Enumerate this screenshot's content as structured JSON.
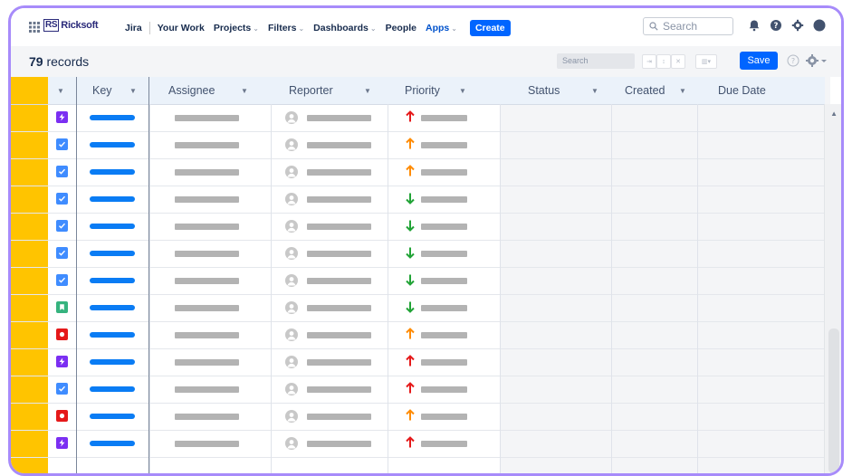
{
  "nav": {
    "brand": "Ricksoft",
    "brand_prefix": "RS",
    "product": "Jira",
    "items": [
      {
        "label": "Your Work",
        "caret": false
      },
      {
        "label": "Projects",
        "caret": true
      },
      {
        "label": "Filters",
        "caret": true
      },
      {
        "label": "Dashboards",
        "caret": true
      },
      {
        "label": "People",
        "caret": false
      },
      {
        "label": "Apps",
        "caret": true
      }
    ],
    "create_label": "Create",
    "search_placeholder": "Search"
  },
  "toolbar": {
    "records_count": "79",
    "records_label": "records",
    "search_placeholder": "Search",
    "save_label": "Save"
  },
  "columns": [
    "Key",
    "Assignee",
    "Reporter",
    "Priority",
    "Status",
    "Created",
    "Due Date"
  ],
  "colors": {
    "accent": "#0065ff",
    "row_marker": "#ffc400",
    "key_link": "#0a7cf4",
    "priority_highest": "#e5191a",
    "priority_high": "#ff8b00",
    "priority_low": "#21a336",
    "type_epic": "#7b2ff2",
    "type_task": "#3f8cff",
    "type_story": "#36b37e",
    "type_bug": "#e5191a"
  },
  "rows": [
    {
      "type": "epic",
      "priority": "highest"
    },
    {
      "type": "task",
      "priority": "high"
    },
    {
      "type": "task",
      "priority": "high"
    },
    {
      "type": "task",
      "priority": "low"
    },
    {
      "type": "task",
      "priority": "low"
    },
    {
      "type": "task",
      "priority": "low"
    },
    {
      "type": "task",
      "priority": "low"
    },
    {
      "type": "story",
      "priority": "low"
    },
    {
      "type": "bug",
      "priority": "high"
    },
    {
      "type": "epic",
      "priority": "highest"
    },
    {
      "type": "task",
      "priority": "highest"
    },
    {
      "type": "bug",
      "priority": "high"
    },
    {
      "type": "epic",
      "priority": "highest"
    }
  ]
}
